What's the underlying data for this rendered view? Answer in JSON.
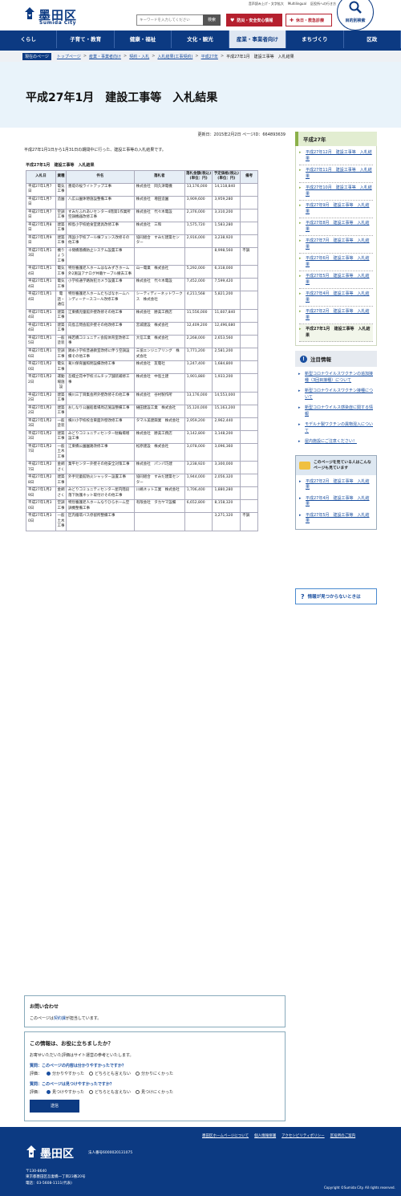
{
  "header": {
    "logo_ja": "墨田区",
    "logo_en": "Sumida City",
    "util_links": [
      "音声読み上げ・文字拡大",
      "Multilingual",
      "区役所への行き方",
      "サイトマップ"
    ],
    "search_placeholder": "キーワードを入力してください",
    "search_button": "検索",
    "quick_disaster": "防災・安全安心情報",
    "quick_holiday": "休日・救急診療",
    "purpose_label": "目的別検索"
  },
  "nav": [
    "くらし",
    "子育て・教育",
    "健康・福祉",
    "文化・観光",
    "産業・事業者向け",
    "まちづくり",
    "区政"
  ],
  "breadcrumb": {
    "here": "現在のページ",
    "items": [
      "トップページ",
      "産業・事業者向け",
      "契約・入札",
      "入札結果(工事契約)",
      "平成27年"
    ],
    "current": "平成27年1月　建設工事等　入札結果"
  },
  "page": {
    "title": "平成27年1月　建設工事等　入札結果",
    "meta": "更新日：2015年2月2日 ページID：664893639",
    "lead": "平成27年1月1日から1月31日の期間中に行った、建設工事等の入札結果です。",
    "table_title": "平成27年1月　建設工事等　入札結果"
  },
  "table": {
    "headers": [
      "入札日",
      "業種",
      "件名",
      "落札者",
      "落札金額(税込)(単位：円)",
      "予定価格(税込)(単位：円)",
      "備考"
    ],
    "rows": [
      [
        "平成27年1月7日",
        "電気工事",
        "墨堤の桜ライトアップ工事",
        "株式会社　岡久津電機",
        "13,176,000",
        "14,118,840",
        ""
      ],
      [
        "平成27年1月7日",
        "造園",
        "八広公園休憩施設整備工事",
        "株式会社　増田造園",
        "3,909,600",
        "3,959,280",
        ""
      ],
      [
        "平成27年1月7日",
        "空調工事",
        "すみだふれあいセンター4階第1作業所空調機器改修工事",
        "株式会社　代々木電設",
        "2,376,000",
        "3,310,200",
        ""
      ],
      [
        "平成27年1月8日",
        "建築工事",
        "柳島小学校給食室建具改修工事",
        "株式会社　三和",
        "1,575,720",
        "1,583,280",
        ""
      ],
      [
        "平成27年1月9日",
        "建築工事",
        "両国小学校プール棟フェンス改修その他工事",
        "協同組合　すみだ建築センター",
        "2,916,000",
        "3,238,920",
        ""
      ],
      [
        "平成27年1月13日",
        "機りょう工事",
        "十間橋落橋防止システム設置工事",
        "",
        "",
        "8,998,560",
        "不調"
      ],
      [
        "平成27年1月14日",
        "電気工事",
        "特別養護老人ホームはなみずきホーム外2施設アナログ共聴ケーブル撤去工事",
        "山一電業　株式会社",
        "5,292,000",
        "6,318,000",
        ""
      ],
      [
        "平成27年1月14日",
        "電気工事",
        "小学校通学路防犯カメラ設置工事",
        "株式会社　代々木電設",
        "7,452,000",
        "7,599,420",
        ""
      ],
      [
        "平成27年1月14日",
        "電話・通信",
        "特別養護老人ホームたちばなホームハンディーナースコール改修工事",
        "シーティディーネットワークス　株式会社",
        "4,211,568",
        "5,821,200",
        ""
      ],
      [
        "平成27年1月14日",
        "建築工事",
        "江東橋児童館外壁改修その他工事",
        "株式会社　勝美工務店",
        "11,556,000",
        "11,607,840",
        ""
      ],
      [
        "平成27年1月14日",
        "建築工事",
        "向島言問会館外壁その他改修工事",
        "宮城建設　株式会社",
        "12,409,200",
        "12,496,680",
        ""
      ],
      [
        "平成27年1月15日",
        "一般塗装",
        "梅若橋コミュニティ会館体育室改修工事",
        "大信工業　株式会社",
        "2,268,000",
        "2,653,560",
        ""
      ],
      [
        "平成27年1月16日",
        "空調工事",
        "錦糸小学校普通教室改修に伴う空調設備その他工事",
        "三協エンジニアリング　株式会社",
        "1,771,200",
        "2,581,200",
        ""
      ],
      [
        "平成27年1月20日",
        "電気工事",
        "菊川保育園照明設備改修工事",
        "株式会社　友電社",
        "1,247,400",
        "1,684,800",
        ""
      ],
      [
        "平成27年1月22日",
        "運動場施設",
        "吾嬬立花中学校ゴムチップ舗装補修工事",
        "株式会社　中島土建",
        "1,901,880",
        "1,933,200",
        ""
      ],
      [
        "平成27年1月22日",
        "建築工事",
        "横川三丁目集会所外壁改修その他工事",
        "株式会社　谷村製作所",
        "13,176,000",
        "14,553,000",
        ""
      ],
      [
        "平成27年1月22日",
        "建築工事",
        "おしなり公園船着場周辺施設整備工事",
        "樋田建設工業　株式会社",
        "15,120,000",
        "15,163,200",
        ""
      ],
      [
        "平成27年1月23日",
        "一般塗装",
        "横川小学校校舎東面外壁改修工事",
        "タマル美建興業　株式会社",
        "2,959,200",
        "2,962,440",
        ""
      ],
      [
        "平成27年1月23日",
        "建築工事",
        "みどりコミュニティセンター駐輪場増設工事",
        "株式会社　勝美工務店",
        "3,142,800",
        "3,148,200",
        ""
      ],
      [
        "平成27年1月27日",
        "一般土木工事",
        "江東橋公園園路改修工事",
        "松原建設　株式会社",
        "3,078,000",
        "3,096,360",
        ""
      ],
      [
        "平成27年1月27日",
        "金網さく",
        "業平センター外壁その他安全対策工事",
        "株式会社　パンパ巧建",
        "3,238,920",
        "3,300,000",
        ""
      ],
      [
        "平成27年1月28日",
        "建築工事",
        "外手児童館防火シャッター設置工事",
        "協同組合　すみだ建築センター",
        "1,944,000",
        "2,056,320",
        ""
      ],
      [
        "平成27年1月29日",
        "金網さく",
        "みどりコミュニティセンター屋内階段落下防護ネット取付けその他工事",
        "川嶋ネット工業　株式会社",
        "1,706,400",
        "1,880,280",
        ""
      ],
      [
        "平成27年1月30日",
        "空調工事",
        "特別養護老人ホームなりひらホーム空調機整備工事",
        "有限会社　タカヤマ設備",
        "6,652,800",
        "8,158,320",
        ""
      ],
      [
        "平成27年1月30日",
        "一般土木工事",
        "区内循環バス停留所整備工事",
        "",
        "",
        "3,271,320",
        "不調"
      ]
    ]
  },
  "contact": {
    "heading": "お問い合わせ",
    "text_before": "このページは",
    "link": "契約課",
    "text_after": "が担当しています。"
  },
  "survey": {
    "heading": "この情報は、お役に立ちましたか？",
    "lead": "お寄せいただいた評価はサイト運営の参考といたします。",
    "q1": "質問：このページの内容は分かりやすかったですか？",
    "q1_label": "評価：",
    "q1_opts": [
      "分かりやすかった",
      "どちらとも言えない",
      "分かりにくかった"
    ],
    "q2": "質問：このページは見つけやすかったですか？",
    "q2_label": "評価：",
    "q2_opts": [
      "見つけやすかった",
      "どちらとも言えない",
      "見つけにくかった"
    ],
    "submit": "送信"
  },
  "sidebar": {
    "year_heading": "平成27年",
    "months": [
      "平成27年12月　建設工事等　入札結果",
      "平成27年11月　建設工事等　入札結果",
      "平成27年10月　建設工事等　入札結果",
      "平成27年9月　建設工事等　入札結果",
      "平成27年8月　建設工事等　入札結果",
      "平成27年7月　建設工事等　入札結果",
      "平成27年6月　建設工事等　入札結果",
      "平成27年5月　建設工事等　入札結果",
      "平成27年4月　建設工事等　入札結果",
      "平成27年2月　建設工事等　入札結果",
      "平成27年1月　建設工事等　入札結果"
    ],
    "attention_heading": "注目情報",
    "attention": [
      "新型コロナウイルスワクチンの追加接種（3回目接種）について",
      "新型コロナウイルスワクチン接種について",
      "新型コロナウイルス感染症に関する情報",
      "モデルナ製ワクチンの異物混入について",
      "屋内施設にご注意ください！"
    ],
    "related_heading": "このページを見ている人はこんなページも見ています",
    "related": [
      "平成27年2月　建設工事等　入札結果",
      "平成27年4月　建設工事等　入札結果",
      "平成27年5月　建設工事等　入札結果"
    ],
    "help": "情報が見つからないときは"
  },
  "footer": {
    "links": [
      "墨田区ホームページについて",
      "個人情報保護",
      "アクセシビリティポリシー",
      "区役所のご案内"
    ],
    "logo": "墨田区",
    "corp_no": "法人番号6000020131075",
    "postal": "〒130-8640",
    "address": "東京都墨田区吾妻橋一丁目23番20号",
    "tel": "電話：03-5608-1111(代表)",
    "copyright": "Copyright ©Sumida City. All rights reserved."
  },
  "colors": {
    "brand_navy": "#0c3a82",
    "alert_red": "#b5202e",
    "title_band": "#e9f3fa",
    "sidebar_green": "#8cb04a"
  }
}
